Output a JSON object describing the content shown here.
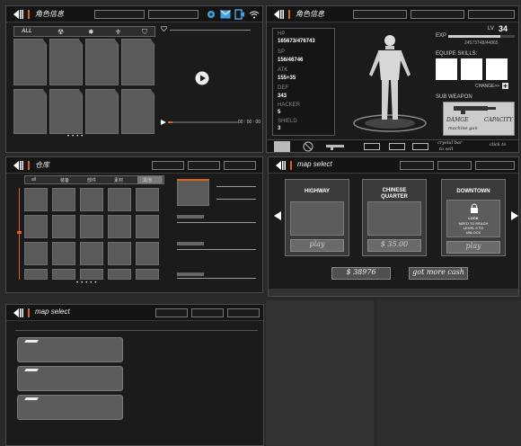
{
  "role_panel": {
    "title": "角色信息",
    "tabs": [
      "ALL",
      "☢",
      "✸",
      "⚜",
      "⛉"
    ],
    "timer": "00 : 00 : 00"
  },
  "char_panel": {
    "title": "角色信息",
    "stats": [
      {
        "label": "HP",
        "value": "165673/476743"
      },
      {
        "label": "SP",
        "value": "156/46746"
      },
      {
        "label": "ATK",
        "value": "155+35"
      },
      {
        "label": "DEF",
        "value": "343"
      },
      {
        "label": "HACKER",
        "value": "5"
      },
      {
        "label": "SHIELD",
        "value": "3"
      }
    ],
    "level_label": "LV",
    "level": "34",
    "exp_label": "EXP",
    "exp_value": "24573748/44865",
    "equip_label": "EQUIPE SKILLS:",
    "change_label": "CHANGE>>",
    "sub_weapon_label": "SUB WEAPON",
    "weapon_notes": [
      "DAMGE",
      "CAPACITY"
    ],
    "weapon_note2": "machine gun",
    "weapon_note3": "click to",
    "bottom_notes": [
      "crystal bar",
      "to sell"
    ]
  },
  "storage_panel": {
    "title": "仓库",
    "tabs": [
      "all",
      "装备",
      "部件",
      "素材",
      "其他"
    ]
  },
  "map_panel": {
    "title": "map select",
    "maps": [
      {
        "name": "HIGHWAY",
        "button": "play"
      },
      {
        "name": "CHINESE QUARTER",
        "button": "$ 35.00"
      },
      {
        "name": "DOWNTOWN",
        "button": "play",
        "locked": "LOCK",
        "lock_note": "NEED TO REACH LEVEL 9 TO UNLOCK"
      }
    ],
    "money": "$ 38976",
    "more_cash": "got more cash"
  },
  "map_panel2": {
    "title": "map select"
  },
  "colors": {
    "accent": "#e06010",
    "panel": "#1b1b1b",
    "slot": "#5a5a5a"
  }
}
